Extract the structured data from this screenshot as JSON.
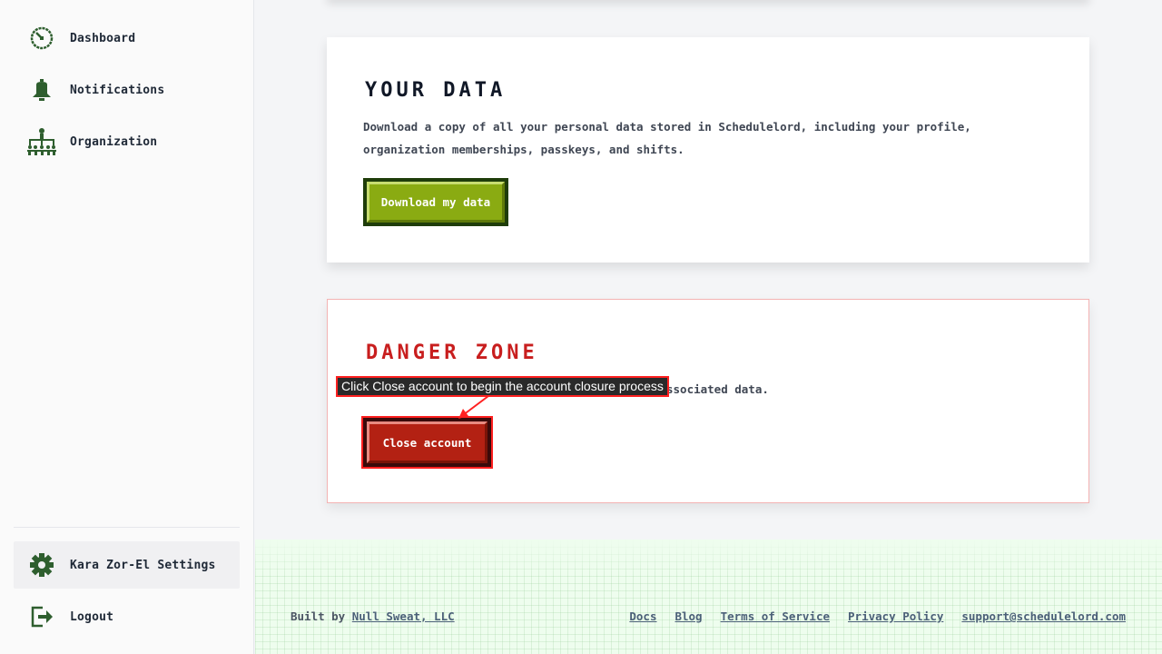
{
  "sidebar": {
    "items": [
      {
        "label": "Dashboard",
        "icon": "dashboard-icon"
      },
      {
        "label": "Notifications",
        "icon": "bell-icon"
      },
      {
        "label": "Organization",
        "icon": "org-chart-icon"
      }
    ],
    "bottom_items": [
      {
        "label": "Kara Zor-El Settings",
        "icon": "gear-icon"
      },
      {
        "label": "Logout",
        "icon": "logout-icon"
      }
    ]
  },
  "your_data": {
    "title": "YOUR DATA",
    "description": "Download a copy of all your personal data stored in Schedulelord, including your profile, organization memberships, passkeys, and shifts.",
    "button_label": "Download my data"
  },
  "danger_zone": {
    "title": "DANGER ZONE",
    "description_visible": "ssociated data.",
    "button_label": "Close account"
  },
  "annotation": {
    "tooltip": "Click Close account to begin the account closure process"
  },
  "footer": {
    "built_by_prefix": "Built by",
    "built_by_link": "Null Sweat, LLC",
    "links": [
      "Docs",
      "Blog",
      "Terms of Service",
      "Privacy Policy",
      "support@schedulelord.com"
    ]
  },
  "colors": {
    "accent_green": "#8aab12",
    "danger_red": "#c81e1e",
    "icon_green": "#2e5e2e"
  }
}
